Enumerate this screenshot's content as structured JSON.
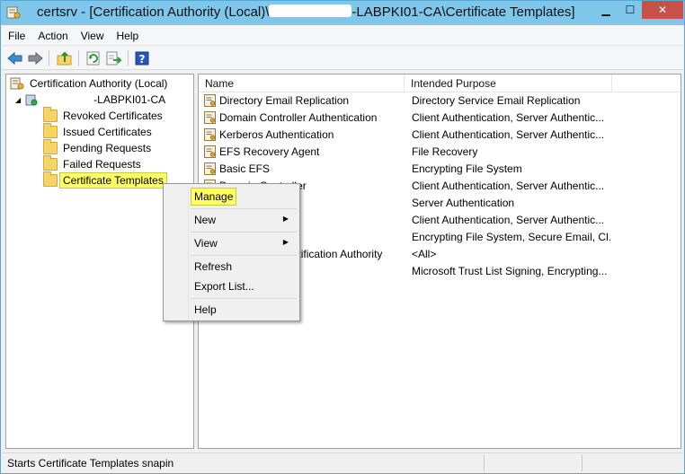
{
  "window": {
    "title_prefix": "certsrv - [Certification Authority (Local)\\",
    "title_suffix": "-LABPKI01-CA\\Certificate Templates]",
    "minimize_label": "▁",
    "maximize_label": "☐",
    "close_label": "✕",
    "title_bar_color": "#7ec6ea",
    "close_color": "#c7504a"
  },
  "menubar": {
    "items": [
      "File",
      "Action",
      "View",
      "Help"
    ]
  },
  "toolbar": {
    "icons": [
      "back-arrow-icon",
      "forward-arrow-icon",
      "up-folder-icon",
      "refresh-icon",
      "export-list-icon",
      "help-icon"
    ]
  },
  "tree": {
    "root_label": "Certification Authority (Local)",
    "ca_label": "-LABPKI01-CA",
    "items": [
      {
        "label": "Revoked Certificates"
      },
      {
        "label": "Issued Certificates"
      },
      {
        "label": "Pending Requests"
      },
      {
        "label": "Failed Requests"
      },
      {
        "label": "Certificate Templates",
        "selected": true
      }
    ]
  },
  "list": {
    "columns": [
      "Name",
      "Intended Purpose"
    ],
    "rows": [
      {
        "name": "Directory Email Replication",
        "purpose": "Directory Service Email Replication"
      },
      {
        "name": "Domain Controller Authentication",
        "purpose": "Client Authentication, Server Authentic..."
      },
      {
        "name": "Kerberos Authentication",
        "purpose": "Client Authentication, Server Authentic..."
      },
      {
        "name": "EFS Recovery Agent",
        "purpose": "File Recovery"
      },
      {
        "name": "Basic EFS",
        "purpose": "Encrypting File System"
      },
      {
        "name": "Domain Controller",
        "purpose": "Client Authentication, Server Authentic..."
      },
      {
        "name": "",
        "purpose": "Server Authentication"
      },
      {
        "name": "",
        "purpose": "Client Authentication, Server Authentic..."
      },
      {
        "name": "",
        "purpose": "Encrypting File System, Secure Email, Cl..."
      },
      {
        "name": "Subordinate Certification Authority",
        "purpose": "<All>"
      },
      {
        "name": "",
        "purpose": "Microsoft Trust List Signing, Encrypting..."
      }
    ]
  },
  "context_menu": {
    "items": [
      {
        "label": "Manage",
        "highlighted": true
      },
      {
        "label": "New",
        "submenu": true
      },
      {
        "label": "View",
        "submenu": true
      },
      {
        "label": "Refresh"
      },
      {
        "label": "Export List..."
      },
      {
        "label": "Help"
      }
    ],
    "submenu_arrow": "▶",
    "highlight_color": "#ffff66"
  },
  "statusbar": {
    "text": "Starts Certificate Templates snapin"
  }
}
